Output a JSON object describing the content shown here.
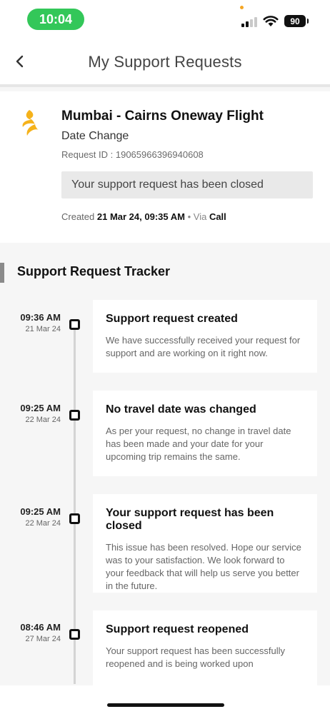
{
  "status_bar": {
    "time": "10:04",
    "battery": "90",
    "icons": [
      "signal-icon",
      "wifi-icon",
      "battery-icon"
    ]
  },
  "header": {
    "title": "My Support Requests",
    "back_icon": "chevron-left-icon"
  },
  "request": {
    "logo_icon": "airline-bird-logo",
    "title": "Mumbai - Cairns Oneway Flight",
    "type": "Date Change",
    "id_text": "Request ID : 19065966396940608",
    "status": "Your support request has been closed",
    "created_label": "Created",
    "created_value": "21 Mar 24, 09:35 AM",
    "via_label": "• Via",
    "via_value": "Call"
  },
  "tracker": {
    "heading": "Support Request Tracker",
    "events": [
      {
        "time": "09:36 AM",
        "date": "21 Mar 24",
        "title": "Support request created",
        "description": "We have successfully received your request for support and are working on it right now."
      },
      {
        "time": "09:25 AM",
        "date": "22 Mar 24",
        "title": "No travel date was changed",
        "description": "As per your request, no change in travel date has been made and your date for your upcoming trip remains the same."
      },
      {
        "time": "09:25 AM",
        "date": "22 Mar 24",
        "title": "Your support request has been closed",
        "description": "This issue has been resolved. Hope our service was to your satisfaction. We look forward to your feedback that will help us serve you better in the future."
      },
      {
        "time": "08:46 AM",
        "date": "27 Mar 24",
        "title": "Support request reopened",
        "description": "Your support request has been successfully reopened and is being worked upon"
      }
    ]
  },
  "colors": {
    "status_green": "#33c759",
    "airline_gold": "#f5b21b",
    "node_border": "#111111",
    "background": "#f6f6f6"
  }
}
